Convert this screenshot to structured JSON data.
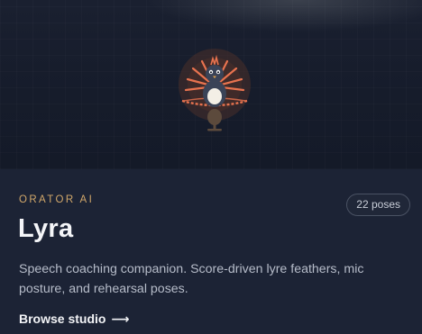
{
  "card": {
    "eyebrow": "ORATOR AI",
    "badge": "22 poses",
    "title": "Lyra",
    "description": "Speech coaching companion. Score-driven lyre feathers, mic posture, and rehearsal poses.",
    "cta_label": "Browse studio",
    "cta_arrow": "⟶"
  },
  "colors": {
    "eyebrow": "#d2a86a",
    "feathers": "#e8734f",
    "bird_body": "#3a4357",
    "background": "#1c2335"
  },
  "icons": {
    "mascot": "lyrebird-mascot-icon",
    "arrow": "arrow-right-icon"
  }
}
